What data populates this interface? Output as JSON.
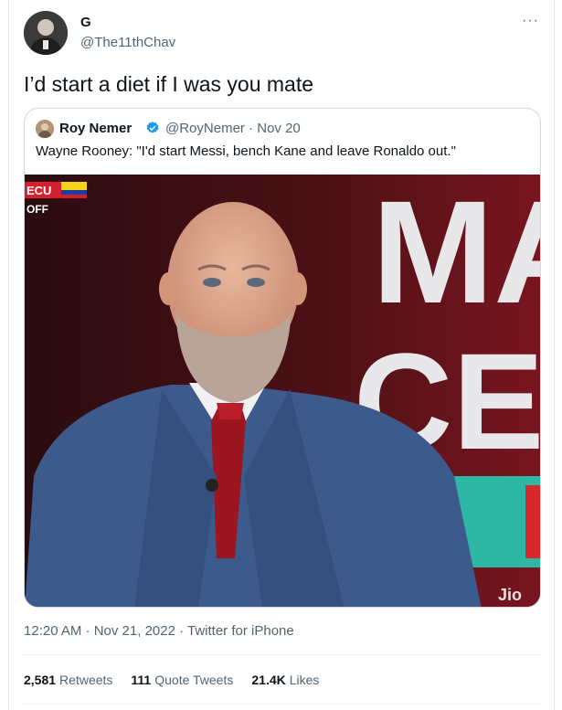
{
  "author": {
    "name": "G",
    "handle": "@The11thChav"
  },
  "tweet": {
    "text": "I’d start a diet if I was you mate"
  },
  "more_icon": "ellipsis-icon",
  "quoted": {
    "name": "Roy Nemer",
    "handle_date": "@RoyNemer · Nov 20",
    "text": "Wayne Rooney: \"I'd start Messi, bench Kane and leave Ronaldo out.\"",
    "image": {
      "score_team": "ECU",
      "score_status": "OFF",
      "bg_letters_1": "MA",
      "bg_letters_2": "CEL",
      "watermark": "Jio"
    }
  },
  "meta": {
    "time": "12:20 AM · Nov 21, 2022 · Twitter for iPhone"
  },
  "stats": {
    "retweets_num": "2,581",
    "retweets_label": "Retweets",
    "quotes_num": "111",
    "quotes_label": "Quote Tweets",
    "likes_num": "21.4K",
    "likes_label": "Likes"
  },
  "colors": {
    "verified": "#1d9bf0",
    "text_secondary": "#536471",
    "border": "#cfd9de"
  }
}
